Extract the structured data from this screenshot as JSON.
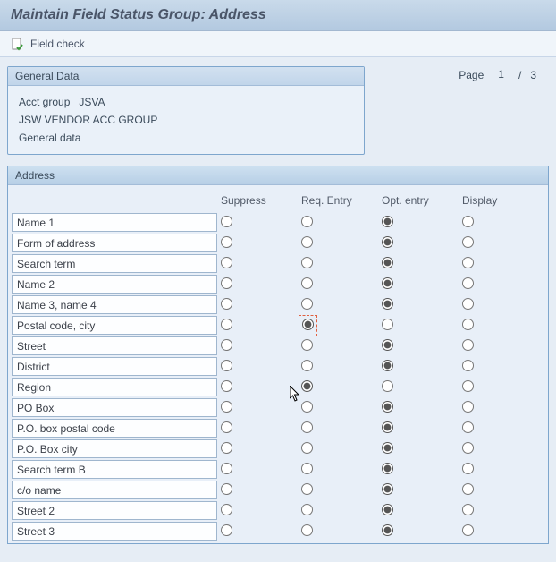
{
  "title": "Maintain Field Status Group: Address",
  "toolbar": {
    "field_check_label": "Field check"
  },
  "general_data": {
    "header": "General Data",
    "rows": [
      {
        "label": "Acct group",
        "value": "JSVA"
      },
      {
        "label": "JSW VENDOR ACC GROUP",
        "value": ""
      },
      {
        "label": "General data",
        "value": ""
      }
    ]
  },
  "pager": {
    "label": "Page",
    "current": "1",
    "sep": "/",
    "total": "3"
  },
  "address": {
    "header": "Address",
    "columns": [
      "Suppress",
      "Req. Entry",
      "Opt. entry",
      "Display"
    ],
    "rows": [
      {
        "label": "Name 1",
        "selected": 2
      },
      {
        "label": "Form of address",
        "selected": 2
      },
      {
        "label": "Search term",
        "selected": 2
      },
      {
        "label": "Name 2",
        "selected": 2
      },
      {
        "label": "Name 3, name 4",
        "selected": 2
      },
      {
        "label": "Postal code, city",
        "selected": 1,
        "focused": true
      },
      {
        "label": "Street",
        "selected": 2
      },
      {
        "label": "District",
        "selected": 2
      },
      {
        "label": "Region",
        "selected": 1
      },
      {
        "label": "PO Box",
        "selected": 2
      },
      {
        "label": "P.O. box postal code",
        "selected": 2
      },
      {
        "label": "P.O. Box city",
        "selected": 2
      },
      {
        "label": "Search term B",
        "selected": 2
      },
      {
        "label": "c/o name",
        "selected": 2
      },
      {
        "label": "Street 2",
        "selected": 2
      },
      {
        "label": "Street 3",
        "selected": 2
      }
    ]
  }
}
